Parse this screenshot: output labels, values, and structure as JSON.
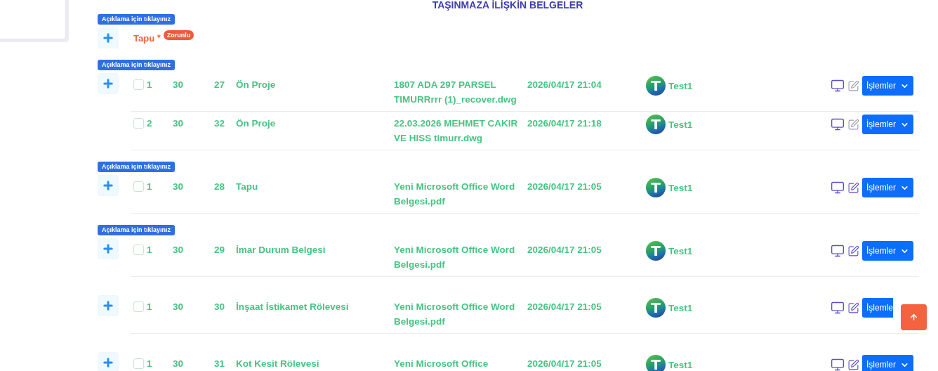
{
  "title": "TAŞINMAZA İLİŞKİN BELGELER",
  "groups": [
    {
      "hint": "Açıklama için tıklayınız",
      "name": "Tapu",
      "required_mark": "*",
      "required_badge": "Zorunlu"
    },
    {
      "hint": "Açıklama için tıklayınız",
      "rows": [
        {
          "checked": false,
          "no": "1",
          "col_2": "30",
          "col_3": "27",
          "type": "Ön Proje",
          "file": "1807 ADA 297 PARSEL TIMURRrrr (1)_recover.dwg",
          "date": "2026/04/17 21:04",
          "avatar_letter": "T",
          "user": "Test1",
          "action": "İşlemler",
          "caret": true
        },
        {
          "checked": false,
          "no": "2",
          "col_2": "30",
          "col_3": "32",
          "type": "Ön Proje",
          "file": "22.03.2026 MEHMET CAKIR VE HISS timurr.dwg",
          "date": "2026/04/17 21:18",
          "avatar_letter": "T",
          "user": "Test1",
          "action": "İşlemler",
          "caret": true
        }
      ]
    },
    {
      "hint": "Açıklama için tıklayınız",
      "rows": [
        {
          "checked": false,
          "no": "1",
          "col_2": "30",
          "col_3": "28",
          "type": "Tapu",
          "file": "Yeni Microsoft Office Word Belgesi.pdf",
          "date": "2026/04/17 21:05",
          "avatar_letter": "T",
          "user": "Test1",
          "action": "İşlemler",
          "caret": true
        }
      ]
    },
    {
      "hint": "Açıklama için tıklayınız",
      "rows": [
        {
          "checked": false,
          "no": "1",
          "col_2": "30",
          "col_3": "29",
          "type": "İmar Durum Belgesi",
          "file": "Yeni Microsoft Office Word Belgesi.pdf",
          "date": "2026/04/17 21:05",
          "avatar_letter": "T",
          "user": "Test1",
          "action": "İşlemler",
          "caret": true
        }
      ]
    },
    {
      "rows": [
        {
          "checked": false,
          "no": "1",
          "col_2": "30",
          "col_3": "30",
          "type": "İnşaat İstikamet Rölevesi",
          "file": "Yeni Microsoft Office Word Belgesi.pdf",
          "date": "2026/04/17 21:05",
          "avatar_letter": "T",
          "user": "Test1",
          "action": "İşlemle",
          "caret": false
        }
      ]
    },
    {
      "rows": [
        {
          "checked": false,
          "no": "1",
          "col_2": "30",
          "col_3": "31",
          "type": "Kot Kesit Rölevesi",
          "file": "Yeni Microsoft Office",
          "date": "2026/04/17 21:05",
          "avatar_letter": "T",
          "user": "Test1",
          "action": "İşlemler",
          "caret": true
        }
      ]
    }
  ]
}
